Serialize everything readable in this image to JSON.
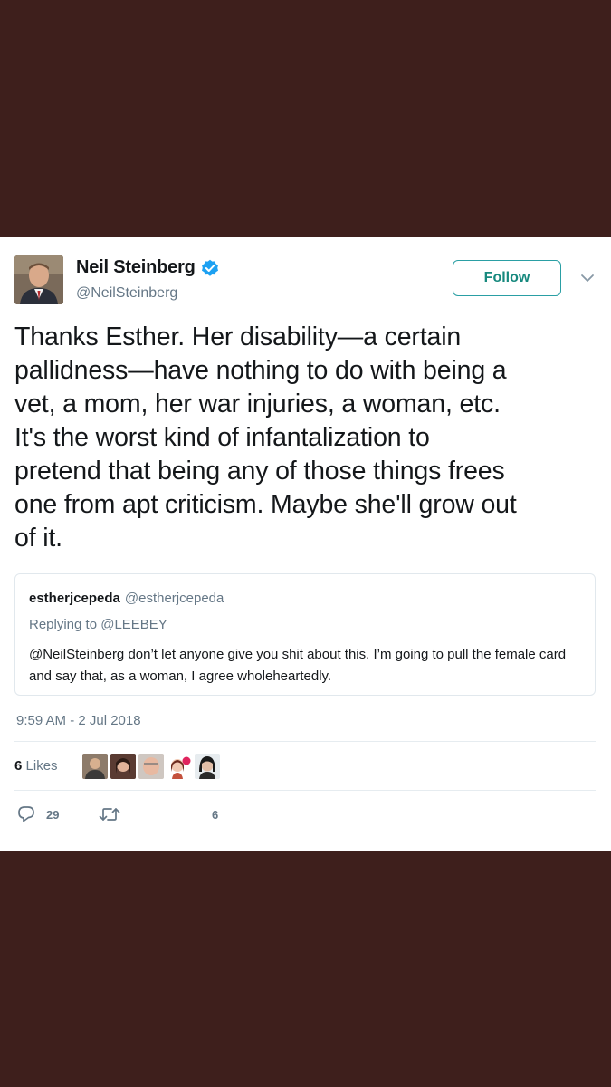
{
  "tweet": {
    "author": {
      "name": "Neil Steinberg",
      "handle": "@NeilSteinberg",
      "verified_icon": "verified-badge-icon"
    },
    "follow_label": "Follow",
    "text": "Thanks Esther. Her disability—a certain\npallidness—have nothing to do with being a\nvet, a mom, her war injuries, a woman, etc.\nIt's the worst kind of infantalization to\npretend that being any of those things frees\none from apt criticism. Maybe she'll grow out\nof it.",
    "quoted": {
      "name": "estherjcepeda",
      "handle": "@estherjcepeda",
      "replying_to": "Replying to @LEEBEY",
      "text": "@NeilSteinberg don’t let anyone give you shit about this. I’m going to pull the female card and say that, as a woman, I agree wholeheartedly."
    },
    "timestamp": "9:59 AM - 2 Jul 2018",
    "likes_count": "6",
    "likes_label": "Likes",
    "actions": {
      "reply_count": "29",
      "retweet_count": "",
      "like_count": "6"
    }
  },
  "colors": {
    "background": "#3e1f1c",
    "card": "#ffffff",
    "accent": "#1da1f2",
    "follow_text": "#17897e",
    "muted": "#657786"
  }
}
